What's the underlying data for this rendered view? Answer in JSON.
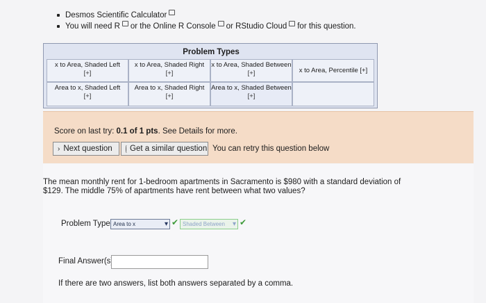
{
  "bullets": [
    {
      "text": "Desmos Scientific Calculator",
      "icon": "external-link-icon"
    },
    {
      "prefix": "You will need ",
      "link1": "R",
      "mid1": " or the ",
      "link2": "Online R Console",
      "mid2": " or ",
      "link3": "RStudio Cloud",
      "suffix": " for this question."
    }
  ],
  "problem_types": {
    "title": "Problem Types",
    "cells": [
      {
        "label": "x to Area, Shaded Left",
        "plus": "[+]"
      },
      {
        "label": "x to Area, Shaded Right",
        "plus": "[+]"
      },
      {
        "label": "x to Area, Shaded Between",
        "plus": "[+]"
      },
      {
        "label": "x to Area, Percentile",
        "plus": "[+]"
      },
      {
        "label": "Area to x, Shaded Left",
        "plus": "[+]"
      },
      {
        "label": "Area to x, Shaded Right",
        "plus": "[+]"
      },
      {
        "label": "Area to x, Shaded Between",
        "plus": "[+]"
      }
    ]
  },
  "score": {
    "prefix": "Score on last try: ",
    "value": "0.1 of 1 pts",
    "suffix": ". See Details for more.",
    "next_label": "Next question",
    "similar_label": "Get a similar question",
    "retry_text": "You can retry this question below"
  },
  "question": {
    "text": "The mean monthly rent for 1-bedroom apartments in Sacramento is $980 with a standard deviation of $129. The middle 75% of apartments have rent between what two values?",
    "ptype_label": "Problem Type:",
    "select1_value": "Area to x",
    "select2_value": "Shaded Between",
    "final_label": "Final Answer(s):",
    "final_value": "",
    "note": "If there are two answers, list both answers separated by a comma."
  },
  "colors": {
    "accent_green": "#3e9a3a",
    "score_band": "#f5dcc7",
    "table_bg": "#dfe4f1"
  }
}
